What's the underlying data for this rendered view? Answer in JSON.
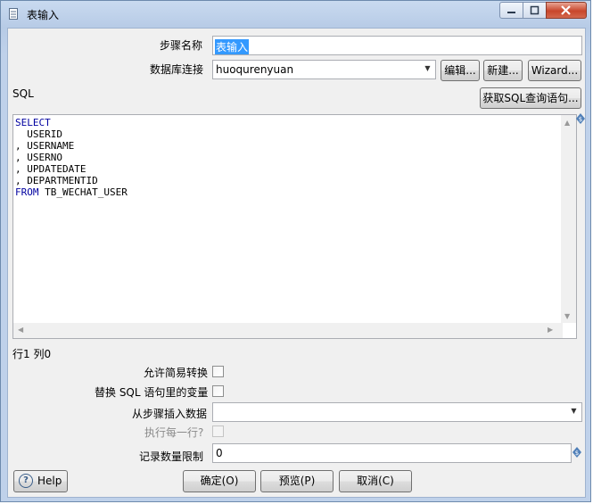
{
  "window": {
    "title": "表输入"
  },
  "form": {
    "step_name_label": "步骤名称",
    "step_name_value": "表输入",
    "db_conn_label": "数据库连接",
    "db_conn_value": "huoqurenyuan",
    "edit_button": "编辑...",
    "new_button": "新建...",
    "wizard_button": "Wizard...",
    "sql_label": "SQL",
    "get_sql_button": "获取SQL查询语句...",
    "sql_lines": [
      {
        "kw": "SELECT",
        "text": ""
      },
      {
        "kw": "",
        "text": "  USERID"
      },
      {
        "kw": "",
        "text": ", USERNAME"
      },
      {
        "kw": "",
        "text": ", USERNO"
      },
      {
        "kw": "",
        "text": ", UPDATEDATE"
      },
      {
        "kw": "",
        "text": ", DEPARTMENTID"
      },
      {
        "kw": "FROM",
        "text": " TB_WECHAT_USER"
      }
    ],
    "cursor_pos": "行1 列0",
    "lazy_conversion_label": "允许简易转换",
    "replace_vars_label": "替换 SQL 语句里的变量",
    "insert_from_step_label": "从步骤插入数据",
    "insert_from_step_value": "",
    "execute_each_row_label": "执行每一行?",
    "limit_label": "记录数量限制",
    "limit_value": "0"
  },
  "footer": {
    "help_button": "Help",
    "ok_button": "确定(O)",
    "preview_button": "预览(P)",
    "cancel_button": "取消(C)"
  },
  "colors": {
    "keyword": "#0000a0",
    "title_bg": "#c9daf0"
  },
  "icons": {
    "title": "table-input-icon",
    "help": "help-icon",
    "variable": "variable-diamond-icon"
  }
}
